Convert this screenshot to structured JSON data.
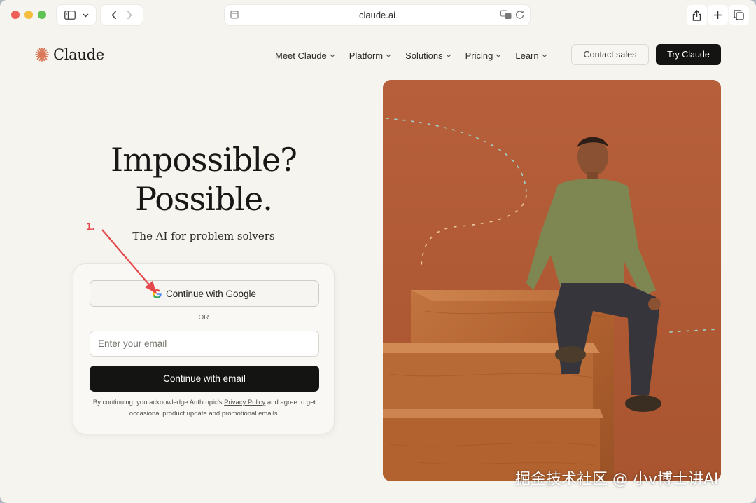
{
  "browser": {
    "url": "claude.ai"
  },
  "site": {
    "logo_text": "Claude",
    "nav": [
      {
        "label": "Meet Claude"
      },
      {
        "label": "Platform"
      },
      {
        "label": "Solutions"
      },
      {
        "label": "Pricing"
      },
      {
        "label": "Learn"
      }
    ],
    "contact_label": "Contact sales",
    "try_label": "Try Claude"
  },
  "hero": {
    "title_line1": "Impossible?",
    "title_line2": "Possible.",
    "subtitle": "The AI for problem solvers"
  },
  "signin": {
    "google_label": "Continue with Google",
    "or_label": "OR",
    "email_placeholder": "Enter your email",
    "email_button": "Continue with email",
    "legal_pre": "By continuing, you acknowledge Anthropic’s ",
    "legal_link": "Privacy Policy",
    "legal_post": " and agree to get occasional product update and promotional emails."
  },
  "annotation": {
    "step_label": "1."
  },
  "watermark": "掘金技术社区 @ 小v博士讲AI",
  "colors": {
    "accent": "#d97757",
    "dark_button": "#141413",
    "annotation": "#e5474a",
    "hero_bg": "#b35e3a"
  }
}
